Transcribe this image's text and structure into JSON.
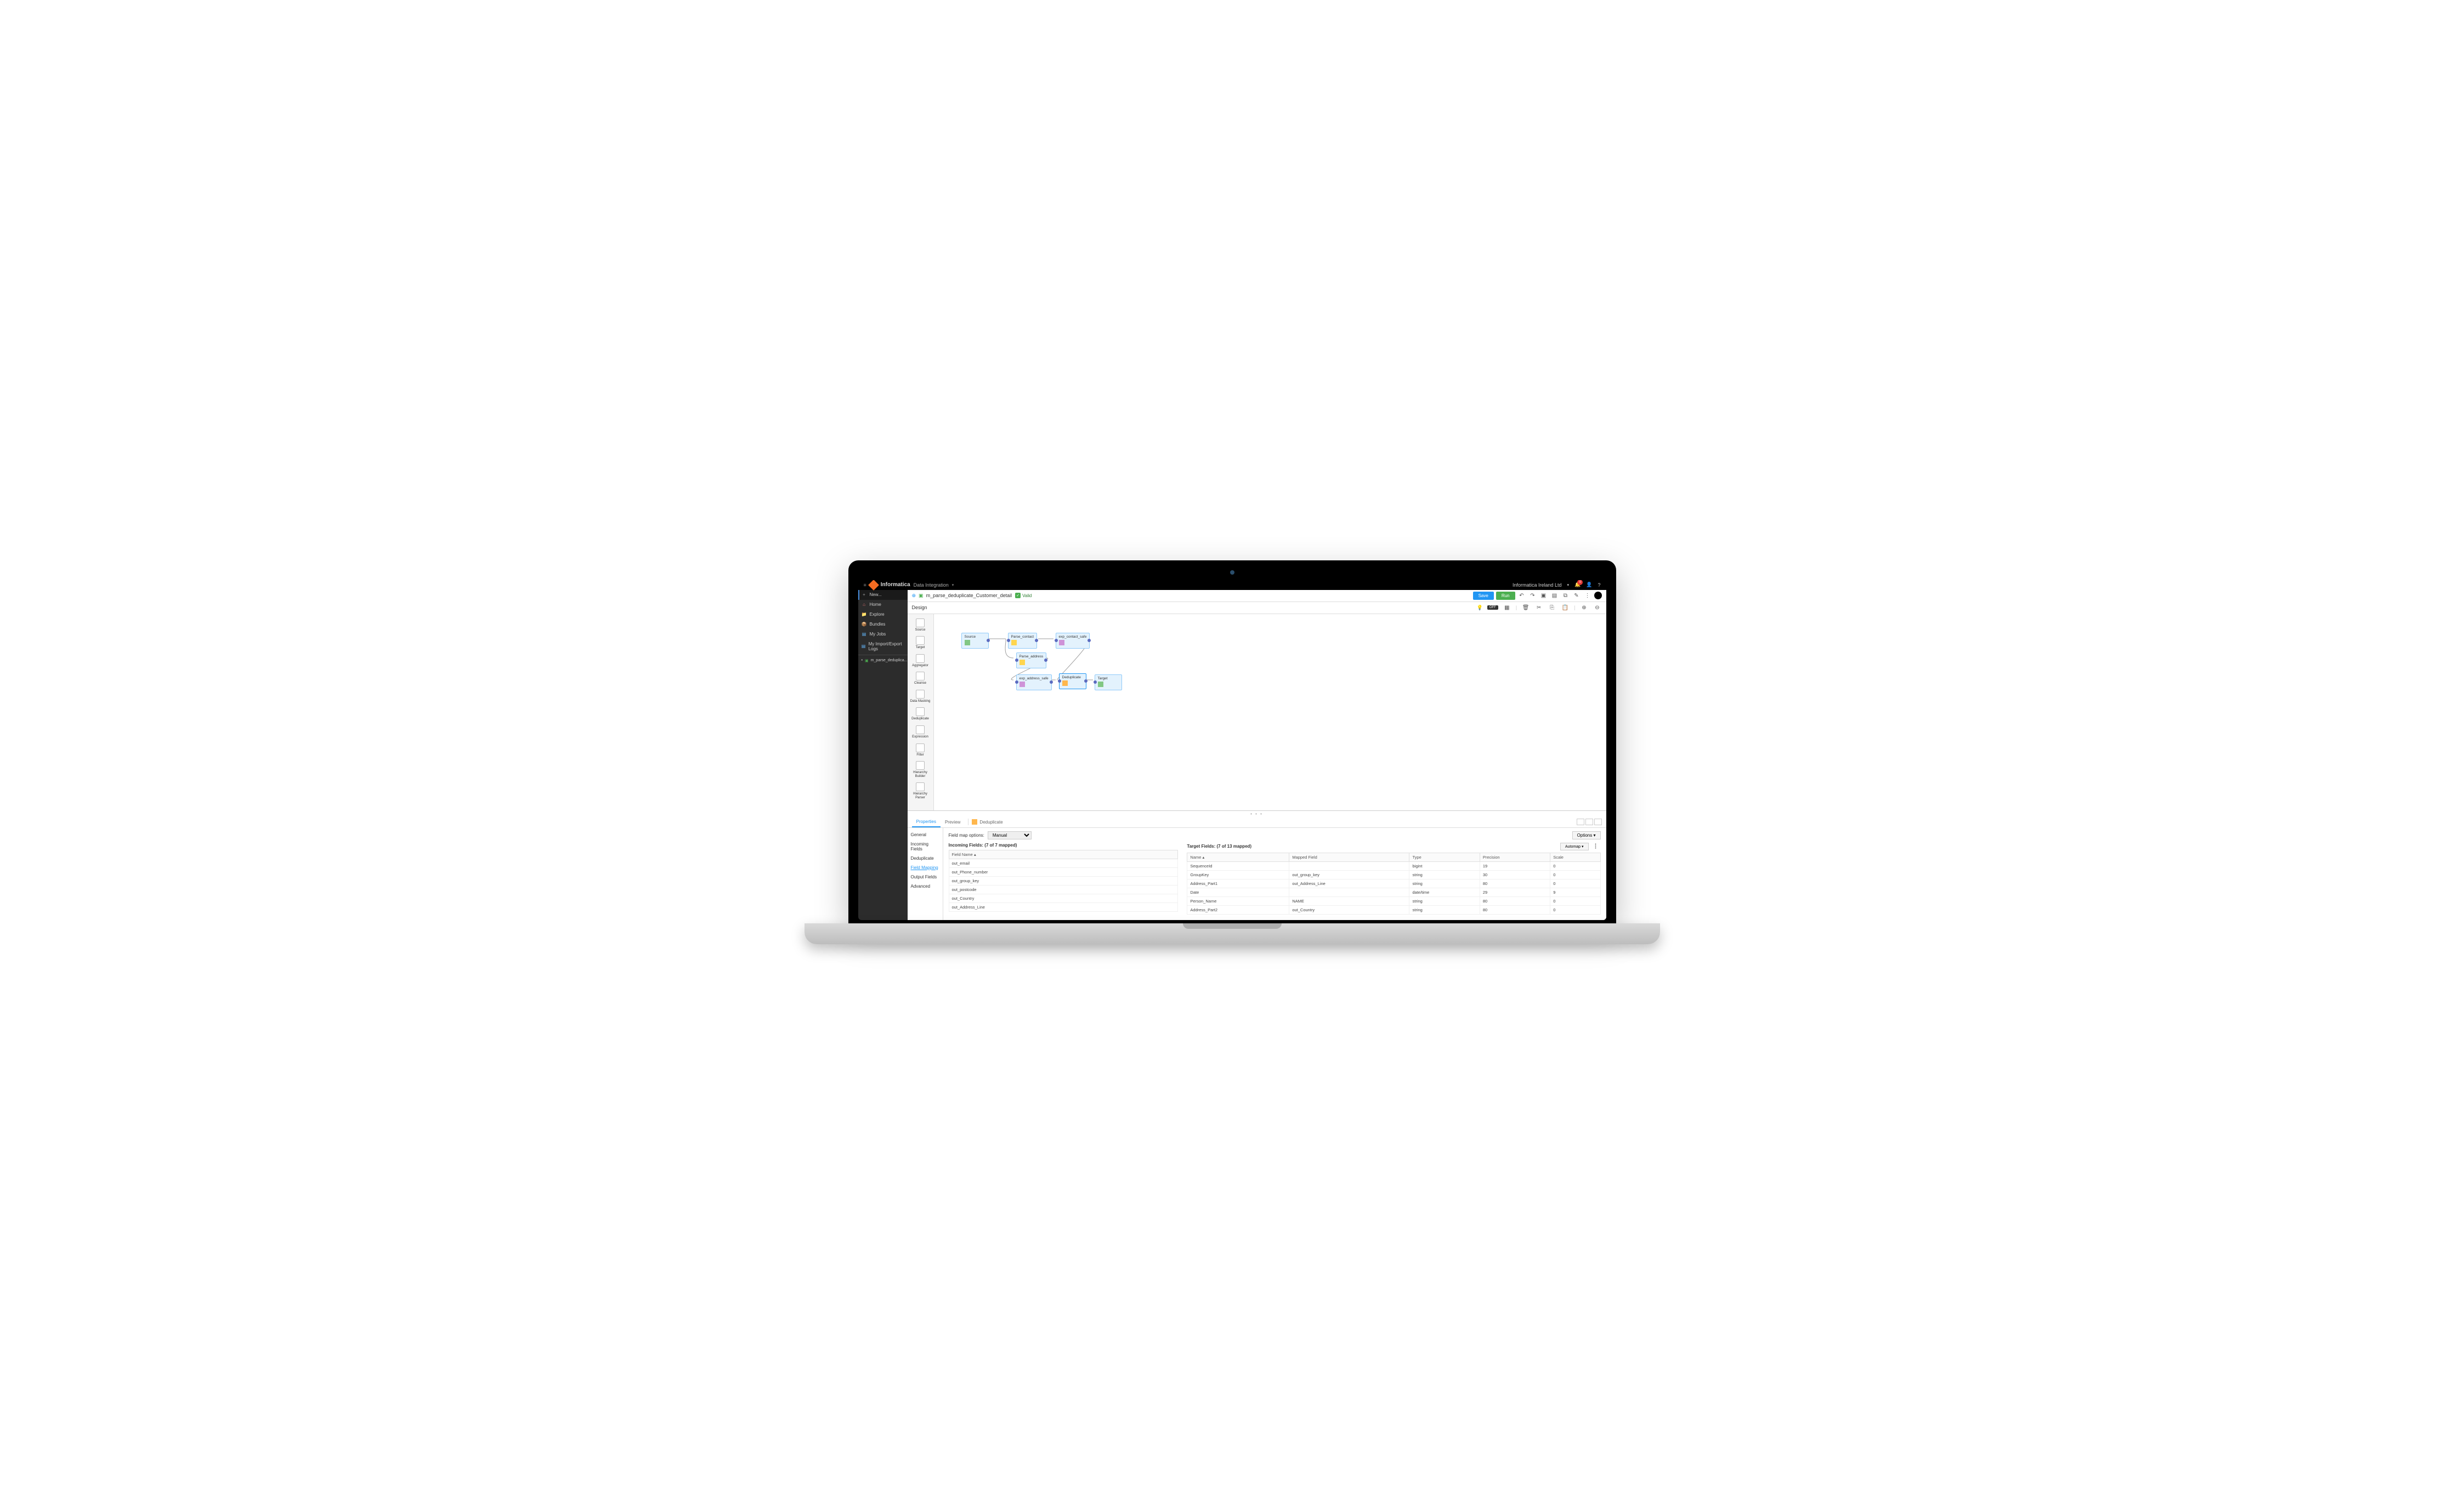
{
  "brand": "Informatica",
  "appName": "Data Integration",
  "org": "Informatica Ireland Ltd",
  "notifCount": "0",
  "sidebar": {
    "items": [
      {
        "label": "New...",
        "icon": "+",
        "color": "#9e9e9e"
      },
      {
        "label": "Home",
        "icon": "⌂",
        "color": "#e57373"
      },
      {
        "label": "Explore",
        "icon": "📁",
        "color": "#ffb74d"
      },
      {
        "label": "Bundles",
        "icon": "📦",
        "color": "#ffb74d"
      },
      {
        "label": "My Jobs",
        "icon": "▤",
        "color": "#64b5f6"
      },
      {
        "label": "My Import/Export Logs",
        "icon": "▤",
        "color": "#64b5f6"
      }
    ],
    "openItem": "m_parse_deduplica..."
  },
  "header": {
    "title": "m_parse_deduplicate_Customer_detail",
    "valid": "Valid",
    "save": "Save",
    "run": "Run"
  },
  "design": {
    "label": "Design",
    "toggle": "OFF"
  },
  "palette": [
    {
      "label": "Source"
    },
    {
      "label": "Target"
    },
    {
      "label": "Aggregator"
    },
    {
      "label": "Cleanse"
    },
    {
      "label": "Data Masking"
    },
    {
      "label": "Deduplicate"
    },
    {
      "label": "Expression"
    },
    {
      "label": "Filter"
    },
    {
      "label": "Hierarchy Builder"
    },
    {
      "label": "Hierarchy Parser"
    }
  ],
  "nodes": {
    "source": "Source",
    "parse_contact": "Parse_contact",
    "exp_contact_safe": "exp_contact_safe",
    "parse_address": "Parse_address",
    "exp_address_safe": "exp_address_safe",
    "dedup": "Deduplicate",
    "target": "Target"
  },
  "panel": {
    "tabs": {
      "props": "Properties",
      "preview": "Preview",
      "dedup": "Deduplicate"
    },
    "sideTabs": [
      "General",
      "Incoming Fields",
      "Deduplicate",
      "Field Mapping",
      "Output Fields",
      "Advanced"
    ],
    "fieldMapLabel": "Field map options:",
    "fieldMapValue": "Manual",
    "optionsBtn": "Options",
    "automapBtn": "Automap",
    "incoming": {
      "title": "Incoming Fields: (7 of 7 mapped)",
      "header": "Field Name",
      "rows": [
        "out_email",
        "out_Phone_number",
        "out_group_key",
        "out_postcode",
        "out_Country",
        "out_Address_Line"
      ]
    },
    "target": {
      "title": "Target Fields: (7 of 13 mapped)",
      "headers": [
        "Name",
        "Mapped Field",
        "Type",
        "Precision",
        "Scale"
      ],
      "rows": [
        [
          "SequenceId",
          "",
          "bigint",
          "19",
          "0"
        ],
        [
          "GroupKey",
          "out_group_key",
          "string",
          "30",
          "0"
        ],
        [
          "Address_Part1",
          "out_Address_Line",
          "string",
          "80",
          "0"
        ],
        [
          "Date",
          "",
          "date/time",
          "29",
          "9"
        ],
        [
          "Person_Name",
          "NAME",
          "string",
          "80",
          "0"
        ],
        [
          "Address_Part2",
          "out_Country",
          "string",
          "80",
          "0"
        ]
      ]
    }
  }
}
